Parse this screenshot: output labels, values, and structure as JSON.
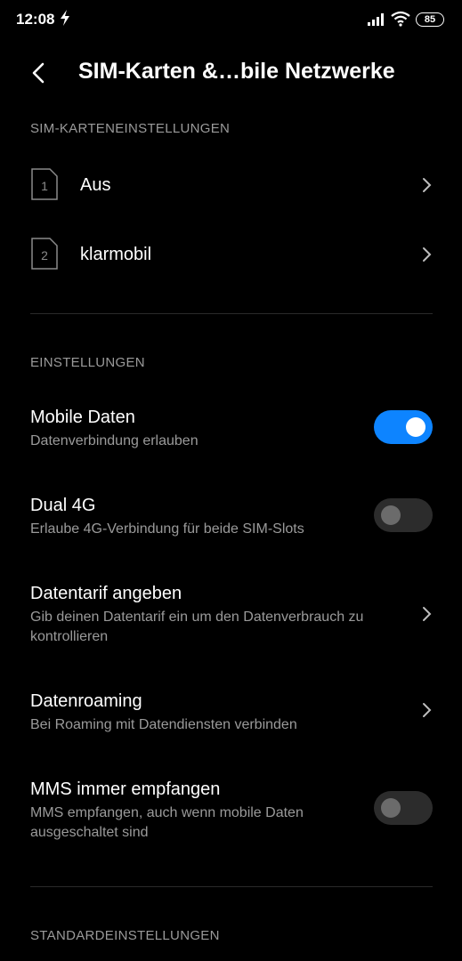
{
  "status_bar": {
    "time": "12:08",
    "battery": "85"
  },
  "header": {
    "title": "SIM-Karten &…bile Netzwerke"
  },
  "sections": {
    "sim": "SIM-KARTENEINSTELLUNGEN",
    "settings": "EINSTELLUNGEN",
    "defaults": "STANDARDEINSTELLUNGEN"
  },
  "sims": [
    {
      "slot": "1",
      "label": "Aus"
    },
    {
      "slot": "2",
      "label": "klarmobil"
    }
  ],
  "settings": {
    "mobile_data": {
      "title": "Mobile Daten",
      "subtitle": "Datenverbindung erlauben",
      "enabled": true
    },
    "dual_4g": {
      "title": "Dual 4G",
      "subtitle": "Erlaube 4G-Verbindung für beide SIM-Slots",
      "enabled": false
    },
    "data_plan": {
      "title": "Datentarif angeben",
      "subtitle_line1": "Gib deinen Datentarif ein um den Datenverbrauch zu",
      "subtitle_line2": "kontrollieren"
    },
    "roaming": {
      "title": "Datenroaming",
      "subtitle": "Bei Roaming mit Datendiensten verbinden"
    },
    "mms": {
      "title": "MMS immer empfangen",
      "subtitle_line1": "MMS empfangen, auch wenn mobile Daten",
      "subtitle_line2": "ausgeschaltet sind",
      "enabled": false
    }
  },
  "colors": {
    "accent": "#0d84ff",
    "background": "#000000",
    "secondary_text": "#9a9a9a"
  }
}
